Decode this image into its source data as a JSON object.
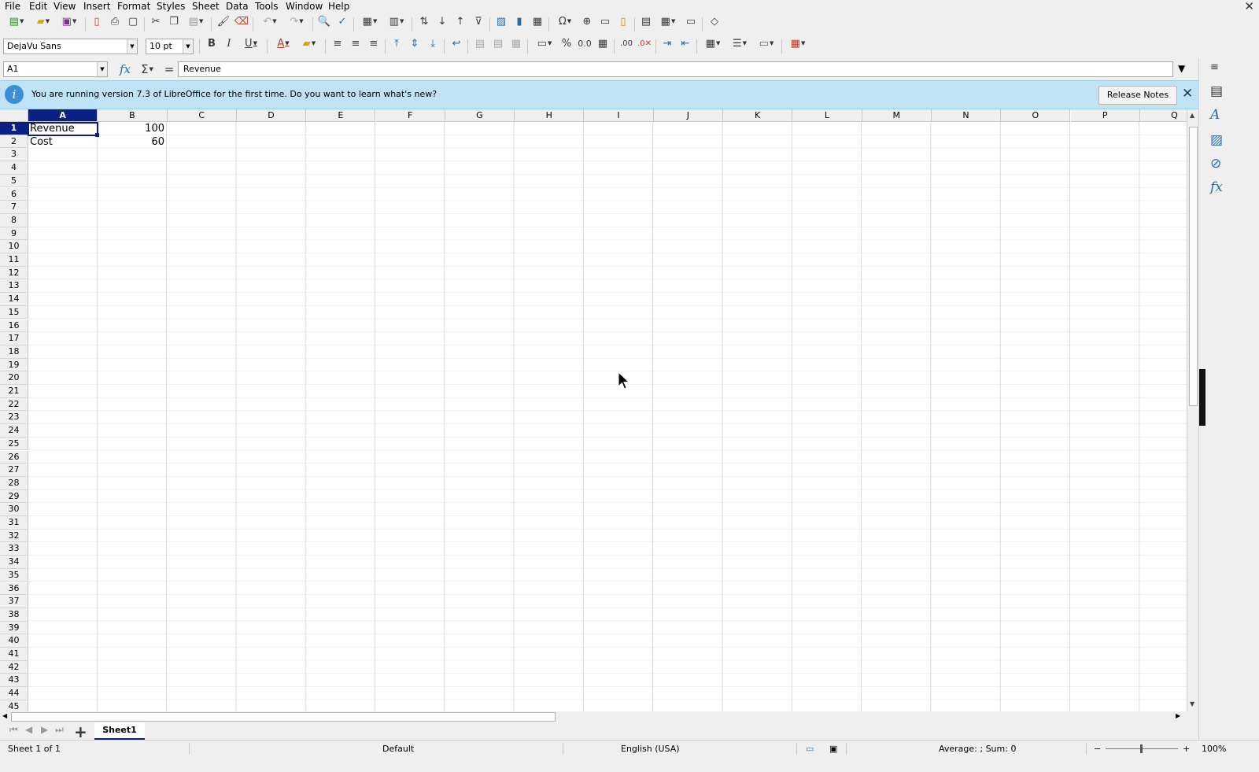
{
  "menu": [
    "File",
    "Edit",
    "View",
    "Insert",
    "Format",
    "Styles",
    "Sheet",
    "Data",
    "Tools",
    "Window",
    "Help"
  ],
  "font": {
    "name": "DejaVu Sans",
    "size": "10 pt"
  },
  "formula": {
    "name_box": "A1",
    "content": "Revenue"
  },
  "infobar": {
    "message": "You are running version 7.3 of LibreOffice for the first time. Do you want to learn what's new?",
    "button": "Release Notes"
  },
  "columns": [
    "A",
    "B",
    "C",
    "D",
    "E",
    "F",
    "G",
    "H",
    "I",
    "J",
    "K",
    "L",
    "M",
    "N",
    "O",
    "P",
    "Q"
  ],
  "selected_column": "A",
  "rows_visible": 45,
  "selected_row": 1,
  "cells": {
    "A1": "Revenue",
    "B1": "100",
    "A2": "Cost",
    "B2": "60"
  },
  "sheet_tab": "Sheet1",
  "status": {
    "sheet": "Sheet 1 of 1",
    "page_style": "Default",
    "language": "English (USA)",
    "summary": "Average: ; Sum: 0",
    "zoom": "100%"
  },
  "colors": {
    "selection": "#0c1f82",
    "infobar": "#bfe3f5"
  }
}
